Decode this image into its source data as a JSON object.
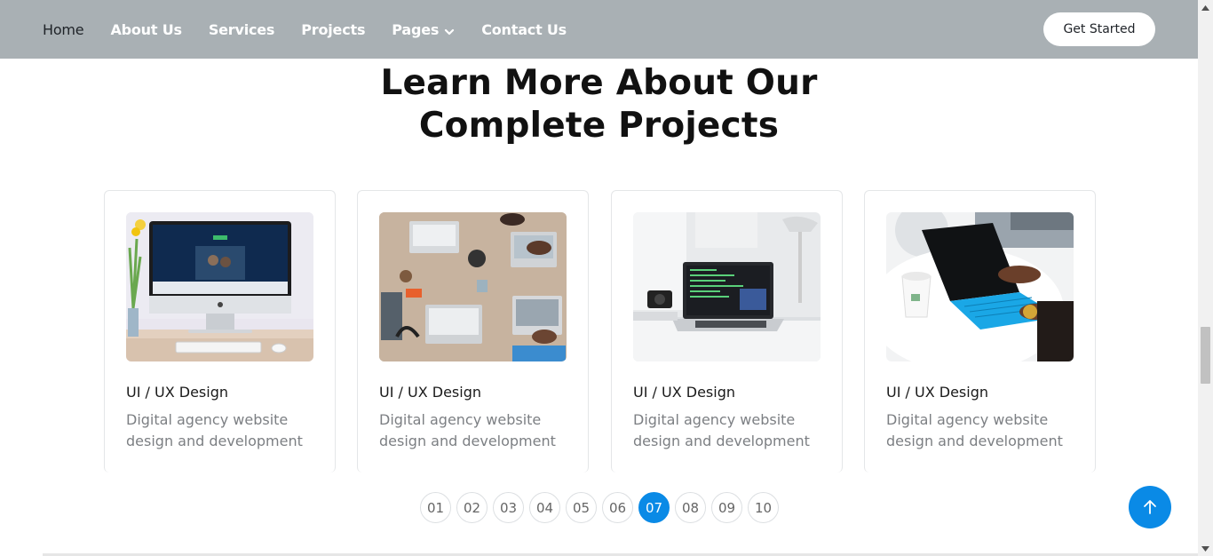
{
  "nav": {
    "items": [
      {
        "label": "Home"
      },
      {
        "label": "About Us"
      },
      {
        "label": "Services"
      },
      {
        "label": "Projects"
      },
      {
        "label": "Pages"
      },
      {
        "label": "Contact Us"
      }
    ],
    "cta_label": "Get Started"
  },
  "section": {
    "heading_line1": "Learn More About Our",
    "heading_line2": "Complete Projects"
  },
  "cards": [
    {
      "title": "UI / UX Design",
      "description": "Digital agency website design and development",
      "image_icon": "imac-desk-photo"
    },
    {
      "title": "UI / UX Design",
      "description": "Digital agency website design and development",
      "image_icon": "team-laptops-table-photo"
    },
    {
      "title": "UI / UX Design",
      "description": "Digital agency website design and development",
      "image_icon": "laptop-code-desk-photo"
    },
    {
      "title": "UI / UX Design",
      "description": "Digital agency website design and development",
      "image_icon": "blue-tablet-typing-photo"
    }
  ],
  "pagination": {
    "pages": [
      "01",
      "02",
      "03",
      "04",
      "05",
      "06",
      "07",
      "08",
      "09",
      "10"
    ],
    "active": "07"
  },
  "colors": {
    "header_bg": "#a9b0b4",
    "accent": "#0a8ae6",
    "heading": "#111111",
    "muted_text": "#7c7f83"
  }
}
